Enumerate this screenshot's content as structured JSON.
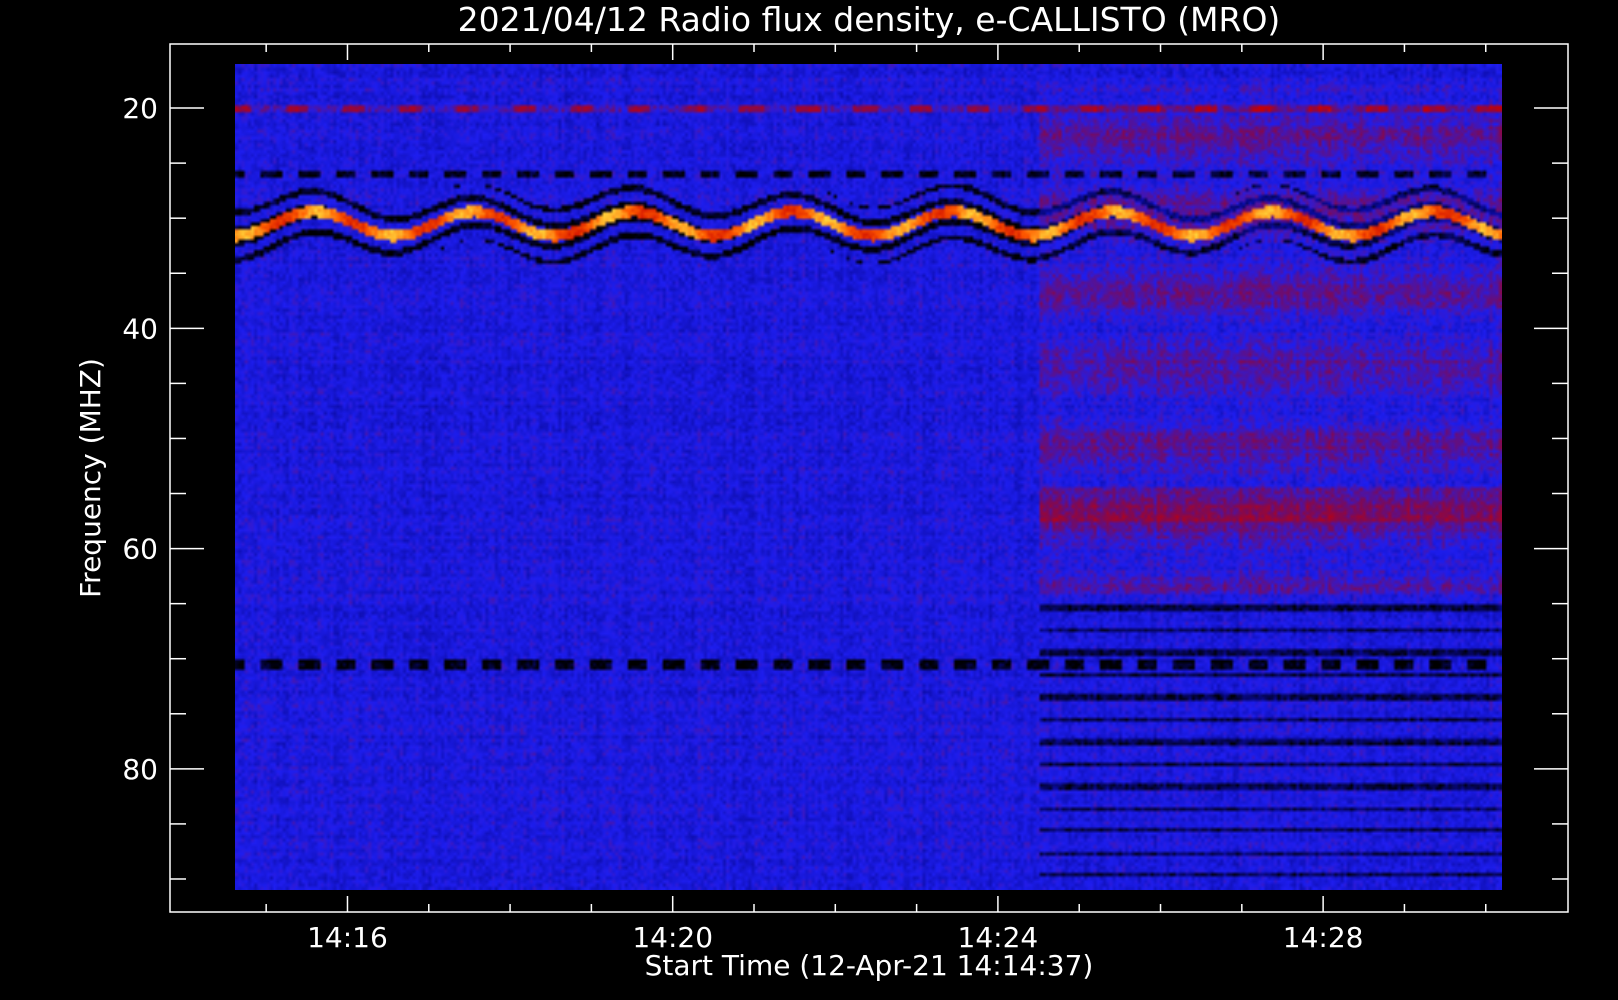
{
  "chart_data": {
    "type": "heatmap",
    "title": "2021/04/12  Radio flux density, e-CALLISTO (MRO)",
    "xlabel": "Start Time (12-Apr-21 14:14:37)",
    "ylabel": "Frequency (MHZ)",
    "x_range": [
      "14:14:37",
      "14:30:12"
    ],
    "y_range": [
      16,
      91
    ],
    "y_inverted": true,
    "x_ticks": [
      "14:16",
      "14:20",
      "14:24",
      "14:28"
    ],
    "y_ticks": [
      20,
      40,
      60,
      80
    ],
    "colormap": [
      "#000000",
      "#0a0aa0",
      "#1e1ef0",
      "#7a0a5a",
      "#c80000",
      "#ff5a00",
      "#ffe040"
    ],
    "features": [
      {
        "description": "strong interference band",
        "freq_mhz": 30.5,
        "intensity": "high"
      },
      {
        "description": "band",
        "freq_mhz": 26,
        "intensity": "dark"
      },
      {
        "description": "band",
        "freq_mhz": 20,
        "intensity": "medium-high"
      },
      {
        "description": "band",
        "freq_mhz": 70.5,
        "intensity": "dark"
      },
      {
        "description": "raised background region",
        "freq_mhz_range": [
          18,
          64
        ],
        "time_start": "14:24:30",
        "intensity": "elevated"
      }
    ]
  }
}
